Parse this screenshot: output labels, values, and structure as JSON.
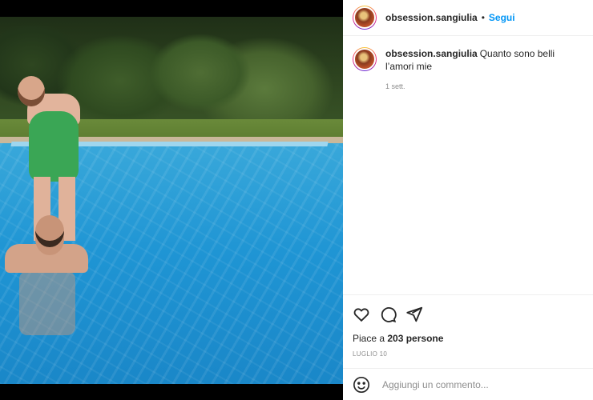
{
  "post": {
    "username": "obsession.sangiulia",
    "dot": "•",
    "follow_label": "Segui",
    "caption_user": "obsession.sangiulia",
    "caption": "Quanto sono belli l’amori mie",
    "caption_age": "1 sett.",
    "likes_text": "Piace a",
    "likes_count": "203 persone",
    "date": "LUGLIO 10",
    "comment_placeholder": "Aggiungi un commento..."
  },
  "icons": {
    "like": "heart-icon",
    "comment": "comment-icon",
    "share": "share-icon",
    "emoji": "emoji-icon"
  },
  "colors": {
    "accent": "#0095f6",
    "text": "#262626",
    "muted": "#8e8e8e"
  }
}
